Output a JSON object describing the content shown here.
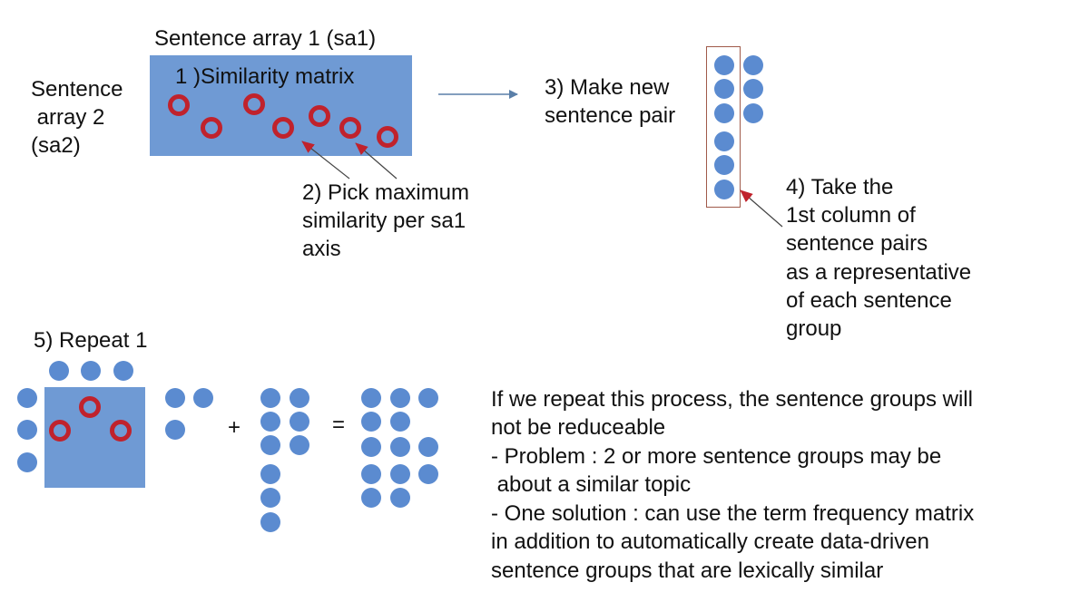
{
  "top": {
    "sa1_label": "Sentence array 1 (sa1)",
    "sa2_label_lines": [
      "Sentence",
      " array 2",
      "(sa2)"
    ],
    "step1_label": "1 )Similarity matrix",
    "step2_lines": [
      "2) Pick maximum",
      "similarity per sa1",
      "axis"
    ],
    "step3_lines": [
      "3) Make new",
      "sentence pair"
    ],
    "step4_lines": [
      "4) Take the",
      "1st column of",
      "sentence pairs",
      "as a representative",
      "of each sentence",
      "group"
    ]
  },
  "bottom": {
    "step5_label": "5) Repeat 1",
    "plus": "+",
    "equals": "=",
    "notes": [
      "If we repeat this process, the sentence groups will",
      "not be reduceable",
      "- Problem : 2 or more sentence groups may be",
      " about a similar topic",
      "- One solution : can use the term frequency matrix",
      "in addition to automatically create data-driven",
      "sentence groups that are lexically similar"
    ]
  },
  "colors": {
    "matrix_fill": "#6f9ad4",
    "circle_fill": "#5b8bd0",
    "max_marker": "#c0222c",
    "arrow_blue": "#5a7fa8",
    "arrow_red": "#c0222c",
    "highlight_box": "#a05a4a"
  }
}
